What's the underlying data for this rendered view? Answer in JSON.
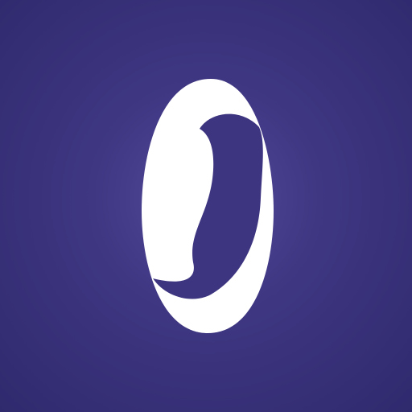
{
  "icon": {
    "name": "app-logo",
    "symbol": "ring-icon",
    "colors": {
      "background_center": "#544a9c",
      "background_edge": "#2f2a6e",
      "logo_fill": "#ffffff"
    }
  }
}
